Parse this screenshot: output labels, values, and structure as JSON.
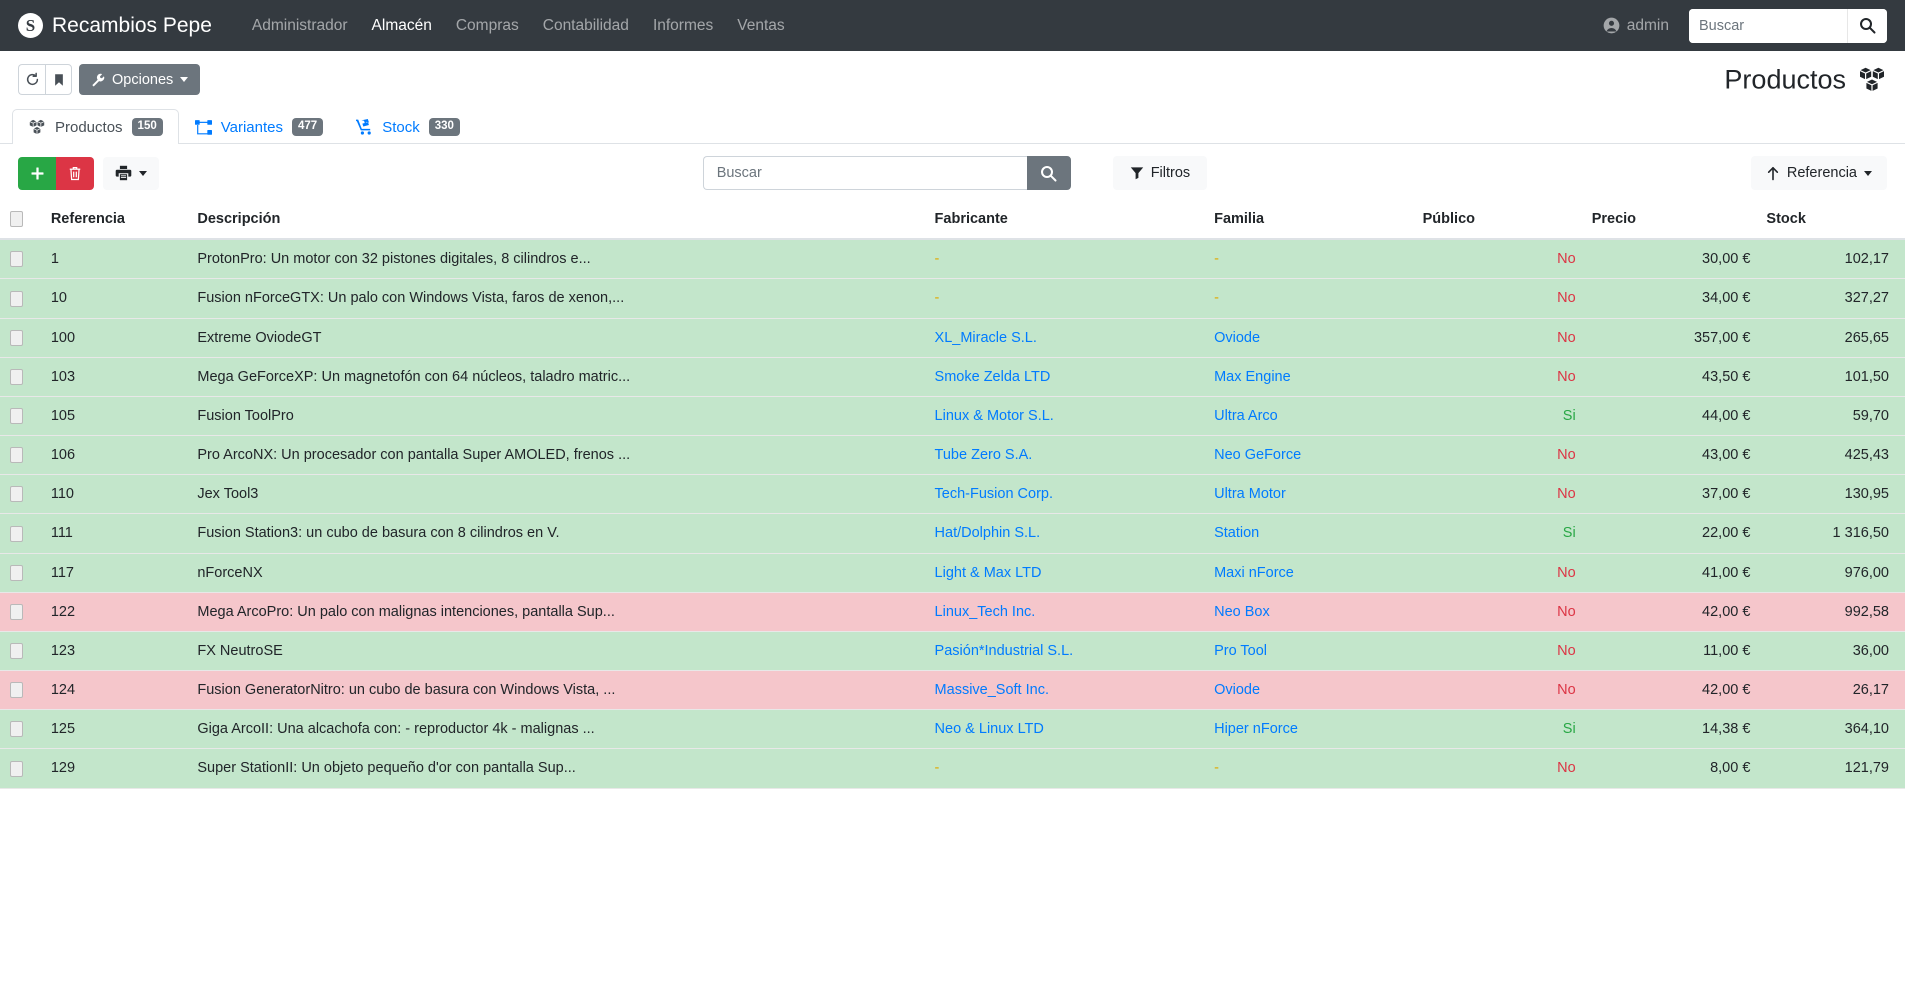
{
  "navbar": {
    "brand": "Recambios Pepe",
    "brand_logo_glyph": "S",
    "links": [
      {
        "label": "Administrador",
        "active": false
      },
      {
        "label": "Almacén",
        "active": true
      },
      {
        "label": "Compras",
        "active": false
      },
      {
        "label": "Contabilidad",
        "active": false
      },
      {
        "label": "Informes",
        "active": false
      },
      {
        "label": "Ventas",
        "active": false
      }
    ],
    "user": "admin",
    "search_placeholder": "Buscar",
    "search_value": ""
  },
  "toolbar": {
    "reload_icon": "reload-icon",
    "bookmark_icon": "bookmark-icon",
    "options_label": "Opciones",
    "page_title": "Productos"
  },
  "tabs": [
    {
      "label": "Productos",
      "count": "150",
      "active": true,
      "icon": "boxes-icon"
    },
    {
      "label": "Variantes",
      "count": "477",
      "active": false,
      "icon": "sitemap-icon"
    },
    {
      "label": "Stock",
      "count": "330",
      "active": false,
      "icon": "dolly-icon"
    }
  ],
  "actions": {
    "new_label": "+",
    "delete_label": "delete",
    "print_label": "print",
    "search_placeholder": "Buscar",
    "search_value": "",
    "filters_label": "Filtros",
    "sort_label": "Referencia"
  },
  "table": {
    "columns": [
      {
        "key": "check",
        "label": ""
      },
      {
        "key": "referencia",
        "label": "Referencia"
      },
      {
        "key": "descripcion",
        "label": "Descripción"
      },
      {
        "key": "fabricante",
        "label": "Fabricante"
      },
      {
        "key": "familia",
        "label": "Familia"
      },
      {
        "key": "publico",
        "label": "Público"
      },
      {
        "key": "precio",
        "label": "Precio"
      },
      {
        "key": "stock",
        "label": "Stock"
      }
    ],
    "rows": [
      {
        "referencia": "1",
        "descripcion": "ProtonPro: Un motor con 32 pistones digitales, 8 cilindros e...",
        "fabricante": "-",
        "familia": "-",
        "publico": "No",
        "precio": "30,00 €",
        "stock": "102,17",
        "state": "ok"
      },
      {
        "referencia": "10",
        "descripcion": "Fusion nForceGTX: Un palo con Windows Vista, faros de xenon,...",
        "fabricante": "-",
        "familia": "-",
        "publico": "No",
        "precio": "34,00 €",
        "stock": "327,27",
        "state": "ok"
      },
      {
        "referencia": "100",
        "descripcion": "Extreme OviodeGT",
        "fabricante": "XL_Miracle S.L.",
        "familia": "Oviode",
        "publico": "No",
        "precio": "357,00 €",
        "stock": "265,65",
        "state": "ok"
      },
      {
        "referencia": "103",
        "descripcion": "Mega GeForceXP: Un magnetofón con 64 núcleos, taladro matric...",
        "fabricante": "Smoke Zelda LTD",
        "familia": "Max Engine",
        "publico": "No",
        "precio": "43,50 €",
        "stock": "101,50",
        "state": "ok"
      },
      {
        "referencia": "105",
        "descripcion": "Fusion ToolPro",
        "fabricante": "Linux & Motor S.L.",
        "familia": "Ultra Arco",
        "publico": "Si",
        "precio": "44,00 €",
        "stock": "59,70",
        "state": "ok"
      },
      {
        "referencia": "106",
        "descripcion": "Pro ArcoNX: Un procesador con pantalla Super AMOLED, frenos ...",
        "fabricante": "Tube Zero S.A.",
        "familia": "Neo GeForce",
        "publico": "No",
        "precio": "43,00 €",
        "stock": "425,43",
        "state": "ok"
      },
      {
        "referencia": "110",
        "descripcion": "Jex Tool3",
        "fabricante": "Tech-Fusion Corp.",
        "familia": "Ultra Motor",
        "publico": "No",
        "precio": "37,00 €",
        "stock": "130,95",
        "state": "ok"
      },
      {
        "referencia": "111",
        "descripcion": "Fusion Station3: un cubo de basura con 8 cilindros en V.",
        "fabricante": "Hat/Dolphin S.L.",
        "familia": "Station",
        "publico": "Si",
        "precio": "22,00 €",
        "stock": "1 316,50",
        "state": "ok"
      },
      {
        "referencia": "117",
        "descripcion": "nForceNX",
        "fabricante": "Light & Max LTD",
        "familia": "Maxi nForce",
        "publico": "No",
        "precio": "41,00 €",
        "stock": "976,00",
        "state": "ok"
      },
      {
        "referencia": "122",
        "descripcion": "Mega ArcoPro: Un palo con malignas intenciones, pantalla Sup...",
        "fabricante": "Linux_Tech Inc.",
        "familia": "Neo Box",
        "publico": "No",
        "precio": "42,00 €",
        "stock": "992,58",
        "state": "warn"
      },
      {
        "referencia": "123",
        "descripcion": "FX NeutroSE",
        "fabricante": "Pasión*Industrial S.L.",
        "familia": "Pro Tool",
        "publico": "No",
        "precio": "11,00 €",
        "stock": "36,00",
        "state": "ok"
      },
      {
        "referencia": "124",
        "descripcion": "Fusion GeneratorNitro: un cubo de basura con Windows Vista, ...",
        "fabricante": "Massive_Soft Inc.",
        "familia": "Oviode",
        "publico": "No",
        "precio": "42,00 €",
        "stock": "26,17",
        "state": "warn"
      },
      {
        "referencia": "125",
        "descripcion": "Giga ArcoII: Una alcachofa con: - reproductor 4k - malignas ...",
        "fabricante": "Neo & Linux LTD",
        "familia": "Hiper nForce",
        "publico": "Si",
        "precio": "14,38 €",
        "stock": "364,10",
        "state": "ok"
      },
      {
        "referencia": "129",
        "descripcion": "Super StationII: Un objeto pequeño d'or con pantalla Sup...",
        "fabricante": "-",
        "familia": "-",
        "publico": "No",
        "precio": "8,00 €",
        "stock": "121,79",
        "state": "ok"
      }
    ]
  },
  "colors": {
    "navbar_bg": "#343a40",
    "link": "#007bff",
    "row_ok": "#c3e6cb",
    "row_warn": "#f5c6cb",
    "no": "#dc3545",
    "si": "#28a745",
    "dash": "#e0a800"
  }
}
